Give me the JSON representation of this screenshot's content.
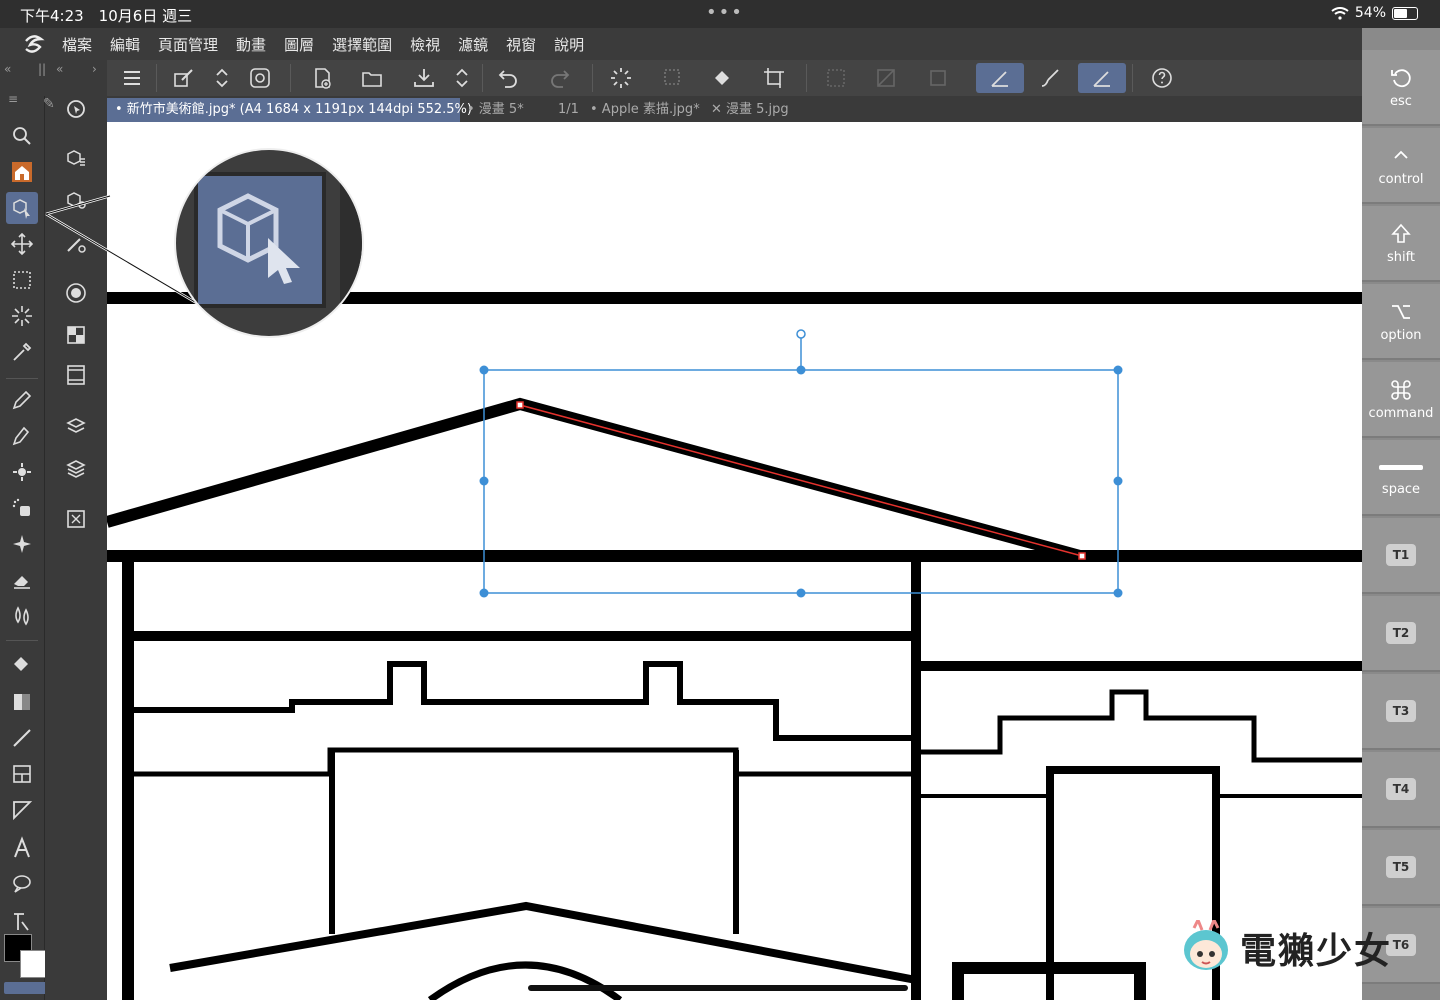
{
  "status": {
    "time": "下午4:23　10月6日 週三",
    "dots": "•••",
    "battery": "54%"
  },
  "menu": [
    "檔案",
    "編輯",
    "頁面管理",
    "動畫",
    "圖層",
    "選擇範圍",
    "檢視",
    "濾鏡",
    "視窗",
    "說明"
  ],
  "tabs": [
    {
      "label": "• 新竹市美術館.jpg* (A4 1684 x 1191px 144dpi 552.5%)",
      "active": true
    },
    {
      "label": "• 漫畫 5*",
      "active": false
    },
    {
      "label": "1/1",
      "active": false
    },
    {
      "label": "• Apple 素描.jpg*",
      "active": false
    },
    {
      "label": "✕ 漫畫 5.jpg",
      "active": false
    }
  ],
  "keys": {
    "esc": "esc",
    "control": "control",
    "shift": "shift",
    "option": "option",
    "command": "command",
    "space": "space",
    "t1": "T1",
    "t2": "T2",
    "t3": "T3",
    "t4": "T4",
    "t5": "T5",
    "t6": "T6"
  },
  "watermark": "電獺少女",
  "colors": {
    "accent": "#5b6e94",
    "selection": "#3d8fd6",
    "vector": "#e5322d"
  }
}
